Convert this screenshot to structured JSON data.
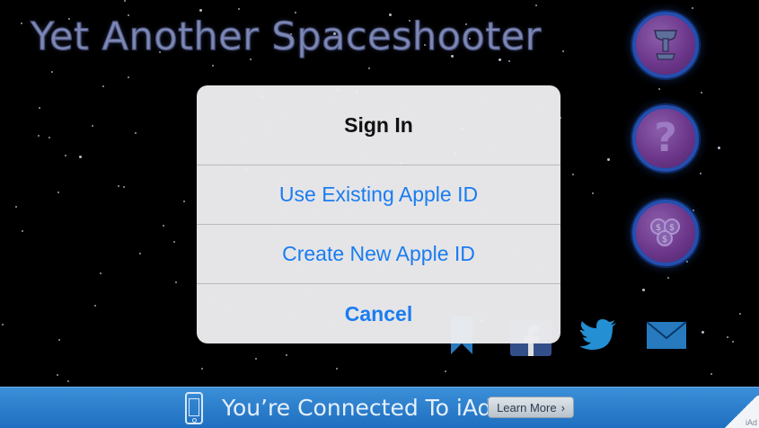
{
  "game": {
    "title": "Yet Another Spaceshooter",
    "buttons": {
      "trophy_icon": "trophy-icon",
      "help_label": "?",
      "coins_icon": "coins-icon"
    },
    "share": {
      "icons": [
        "bookmark-icon",
        "facebook-icon",
        "twitter-icon",
        "mail-icon"
      ]
    }
  },
  "alert": {
    "title": "Sign In",
    "buttons": {
      "existing": "Use Existing Apple ID",
      "create": "Create New Apple ID",
      "cancel": "Cancel"
    }
  },
  "ad_banner": {
    "text": "You’re Connected To iAd",
    "learn_more": "Learn More",
    "learn_more_chevron": "›",
    "corner_label": "iAd"
  },
  "colors": {
    "alert_button": "#1b7cf0",
    "ad_blue": "#2a7ccc",
    "button_purple": "#7c3f9e",
    "button_ring": "#2a5bc8"
  }
}
